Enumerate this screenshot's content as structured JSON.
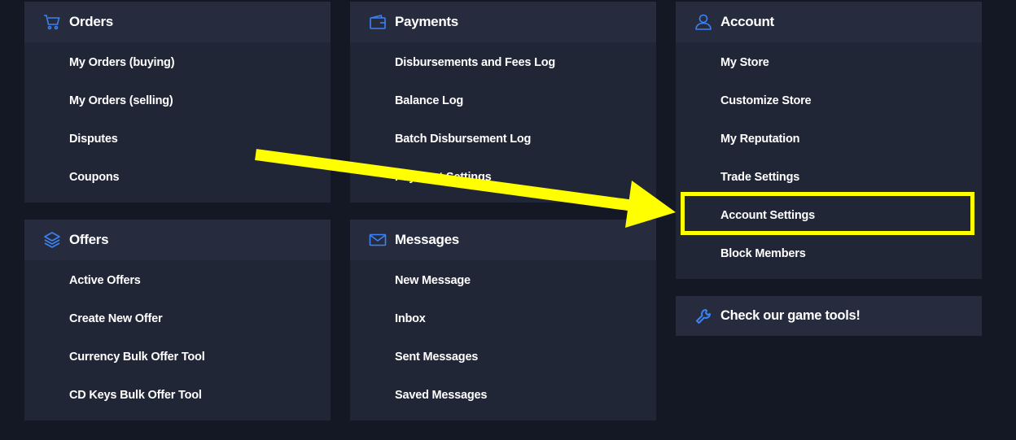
{
  "orders": {
    "title": "Orders",
    "icon": "cart-icon",
    "items": [
      "My Orders (buying)",
      "My Orders (selling)",
      "Disputes",
      "Coupons"
    ]
  },
  "offers": {
    "title": "Offers",
    "icon": "layers-icon",
    "items": [
      "Active Offers",
      "Create New Offer",
      "Currency Bulk Offer Tool",
      "CD Keys Bulk Offer Tool"
    ]
  },
  "payments": {
    "title": "Payments",
    "icon": "wallet-icon",
    "items": [
      "Disbursements and Fees Log",
      "Balance Log",
      "Batch Disbursement Log",
      "Payment Settings"
    ]
  },
  "messages": {
    "title": "Messages",
    "icon": "envelope-icon",
    "items": [
      "New Message",
      "Inbox",
      "Sent Messages",
      "Saved Messages"
    ]
  },
  "account": {
    "title": "Account",
    "icon": "user-icon",
    "items": [
      "My Store",
      "Customize Store",
      "My Reputation",
      "Trade Settings",
      "Account Settings",
      "Block Members"
    ]
  },
  "tools": {
    "title": "Check our game tools!",
    "icon": "wrench-icon"
  },
  "colors": {
    "background": "#141824",
    "card": "#212636",
    "card_header": "#262c3e",
    "icon_blue": "#3b82f6",
    "highlight": "#ffff00"
  }
}
